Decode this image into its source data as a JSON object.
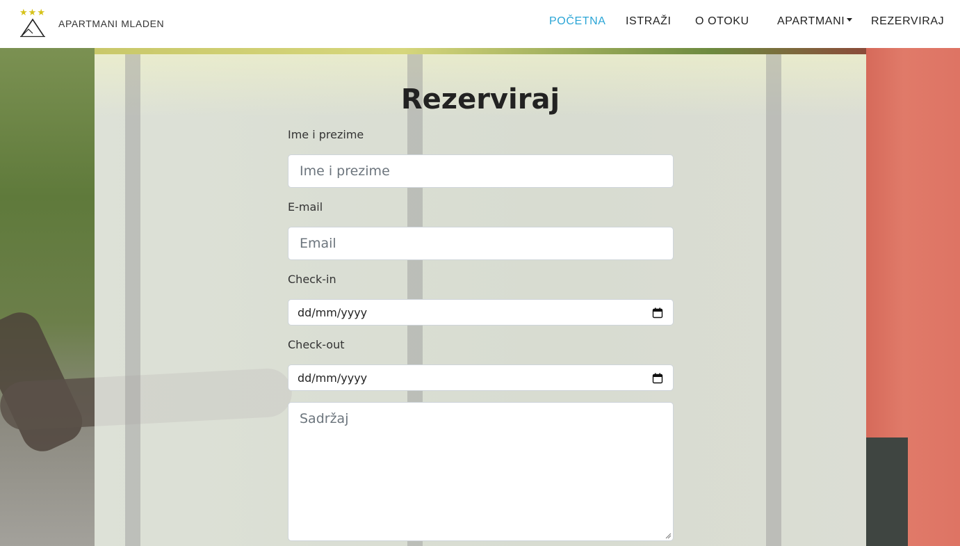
{
  "brand": {
    "stars": "★★★",
    "name": "APARTMANI MLADEN"
  },
  "nav": [
    {
      "label": "POČETNA",
      "active": true
    },
    {
      "label": "ISTRAŽI",
      "active": false
    },
    {
      "label": "O OTOKU",
      "active": false
    },
    {
      "label": "APARTMANI",
      "active": false,
      "dropdown": true
    },
    {
      "label": "REZERVIRAJ",
      "active": false
    }
  ],
  "form": {
    "title": "Rezerviraj",
    "name_label": "Ime i prezime",
    "name_placeholder": "Ime i prezime",
    "email_label": "E-mail",
    "email_placeholder": "Email",
    "checkin_label": "Check-in",
    "checkin_value": "dd/mm/yyyy",
    "checkout_label": "Check-out",
    "checkout_value": "dd/mm/yyyy",
    "message_placeholder": "Sadržaj"
  },
  "colors": {
    "active_nav": "#2aa5d6",
    "stars": "#d6c21a"
  },
  "icons": {
    "date_picker": "calendar-icon"
  }
}
